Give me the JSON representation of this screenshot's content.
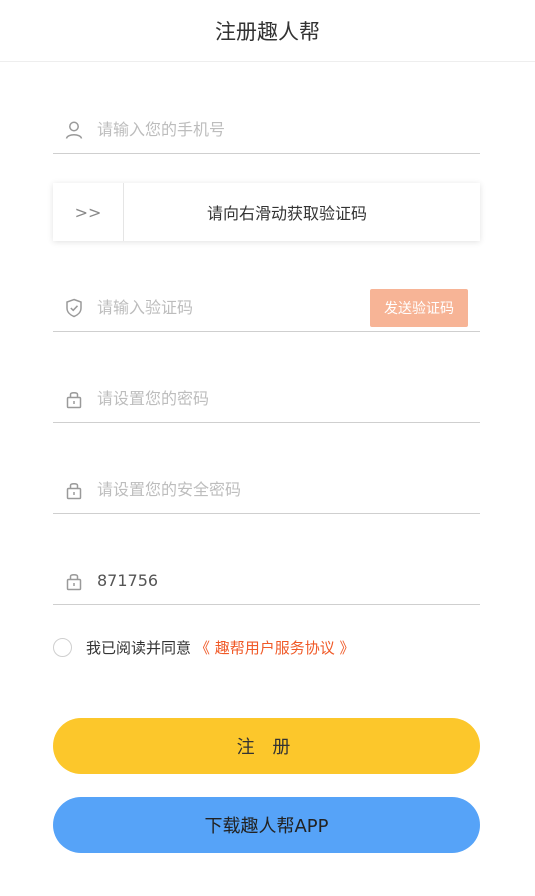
{
  "header": {
    "title": "注册趣人帮"
  },
  "form": {
    "phone": {
      "placeholder": "请输入您的手机号",
      "value": "",
      "icon": "user-icon"
    },
    "slider": {
      "label": "请向右滑动获取验证码",
      "handle_glyph": ">>",
      "icon": "double-chevron-right-icon"
    },
    "code": {
      "placeholder": "请输入验证码",
      "value": "",
      "icon": "shield-check-icon",
      "send_label": "发送验证码",
      "send_color": "#f7b496"
    },
    "password": {
      "placeholder": "请设置您的密码",
      "value": "",
      "icon": "lock-icon"
    },
    "safe_password": {
      "placeholder": "请设置您的安全密码",
      "value": "",
      "icon": "lock-icon"
    },
    "invite": {
      "placeholder": "",
      "value": "871756",
      "icon": "lock-icon"
    }
  },
  "agreement": {
    "prefix": "我已阅读并同意",
    "link": "《 趣帮用户服务协议 》",
    "link_color": "#f05a28",
    "checked": false
  },
  "buttons": {
    "register": {
      "label": "注 册",
      "color": "#fcc72b"
    },
    "download": {
      "label": "下载趣人帮APP",
      "color": "#56a3f8"
    }
  }
}
